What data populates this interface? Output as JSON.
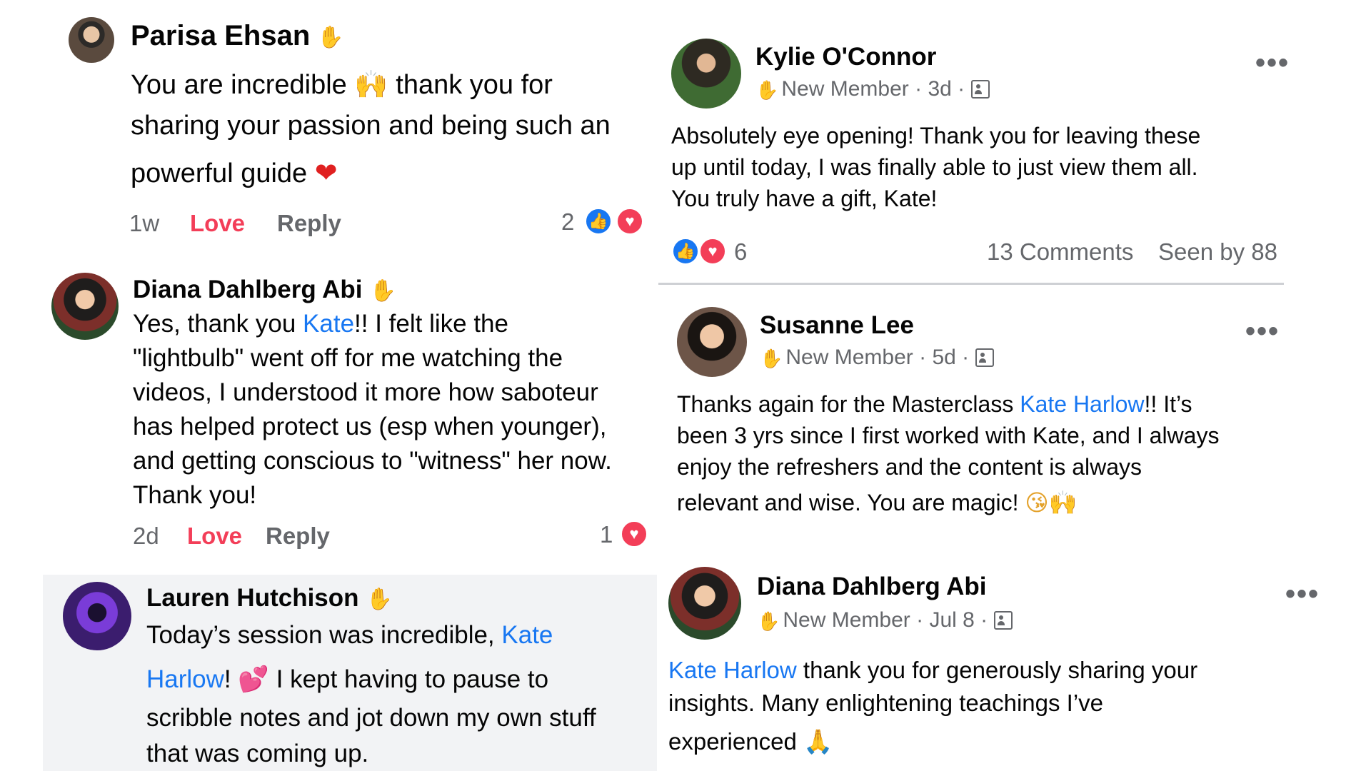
{
  "left_column": {
    "comment1": {
      "author": "Parisa Ehsan",
      "lines": [
        "You are incredible",
        "thank you for",
        "sharing your passion and being such an",
        "powerful guide"
      ],
      "emoji_raised_hands": "🙌",
      "emoji_heart": "❤",
      "time": "1w",
      "love_label": "Love",
      "reply_label": "Reply",
      "reaction_count": "2"
    },
    "comment2": {
      "author": "Diana Dahlberg Abi",
      "line1_pre": "Yes, thank you ",
      "line1_mention": "Kate",
      "line1_post": "!! I felt like the",
      "lines": [
        "\"lightbulb\" went off for me watching the",
        "videos, I understood it more how saboteur",
        "has helped protect us (esp when younger),",
        "and getting conscious to \"witness\" her now.",
        "Thank you!"
      ],
      "time": "2d",
      "love_label": "Love",
      "reply_label": "Reply",
      "reaction_count": "1"
    },
    "comment3": {
      "author": "Lauren Hutchison",
      "line1_pre": "Today’s session was incredible, ",
      "line1_mention": "Kate",
      "line2_mention": "Harlow",
      "line2_post": "!",
      "line2_emoji": "💕",
      "line2_rest": " I kept having to pause to",
      "line3": "scribble notes and jot down my own stuff",
      "line4": "that was coming up."
    }
  },
  "right_column": {
    "post1": {
      "author": "Kylie O'Connor",
      "badge": "New Member",
      "time": "3d",
      "sep": "·",
      "more": "•••",
      "lines": [
        "Absolutely eye opening! Thank you for leaving these",
        "up until today, I was finally able to just view them all.",
        "You truly have a gift, Kate!"
      ],
      "reaction_count": "6",
      "comments": "13 Comments",
      "seen_by": "Seen by 88"
    },
    "post2": {
      "author": "Susanne Lee",
      "badge": "New Member",
      "time": "5d",
      "sep": "·",
      "more": "•••",
      "line1_pre": "Thanks again for the Masterclass ",
      "line1_mention": "Kate Harlow",
      "line1_post": "!! It’s",
      "lines": [
        "been 3 yrs since I first worked with Kate, and I always",
        "enjoy the refreshers and the content is always"
      ],
      "line4": "relevant and wise. You are magic!",
      "line4_emoji": "😘🙌"
    },
    "post3": {
      "author": "Diana Dahlberg Abi",
      "badge": "New Member",
      "time": "Jul 8",
      "sep": "·",
      "more": "•••",
      "line1_mention": "Kate Harlow",
      "line1_post": " thank you for generously sharing your",
      "line2": "insights. Many enlightening teachings I’ve",
      "line3": "experienced",
      "line3_emoji": "🙏"
    }
  },
  "icons": {
    "wave": "✋",
    "like": "👍",
    "heart": "♥"
  },
  "colors": {
    "mention": "#1877f2",
    "love": "#f33e58",
    "meta": "#65676b",
    "card_bg": "#f2f3f5"
  }
}
